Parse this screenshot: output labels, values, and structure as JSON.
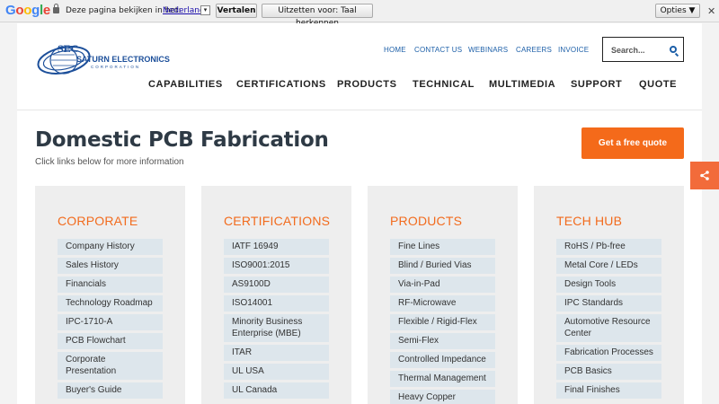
{
  "translate_bar": {
    "logo": [
      "G",
      "o",
      "o",
      "g",
      "l",
      "e"
    ],
    "prompt": "Deze pagina bekijken in het:",
    "language": "Nederlands",
    "translate_button": "Vertalen",
    "disable_button": "Uitzetten voor: Taal herkennen",
    "options_button": "Opties ▼",
    "close": "✕"
  },
  "header": {
    "logo_text_1": "SEC",
    "logo_text_2": "SATURN ELECTRONICS",
    "logo_text_3": "CORPORATION",
    "top_links": [
      "HOME",
      "CONTACT US",
      "WEBINARS",
      "CAREERS",
      "INVOICE"
    ],
    "search_placeholder": "Search...",
    "main_nav": [
      "CAPABILITIES",
      "CERTIFICATIONS",
      "PRODUCTS",
      "TECHNICAL",
      "MULTIMEDIA",
      "SUPPORT",
      "QUOTE"
    ]
  },
  "page": {
    "title": "Domestic PCB Fabrication",
    "subtitle": "Click links below for more information",
    "quote_button": "Get a free quote"
  },
  "colors": {
    "accent": "#f46a1a",
    "nav_blue": "#1c5fa8",
    "link_bg": "#dde6ec"
  },
  "columns": [
    {
      "heading": "CORPORATE",
      "items": [
        "Company History",
        "Sales History",
        "Financials",
        "Technology Roadmap",
        "IPC-1710-A",
        "PCB Flowchart",
        "Corporate Presentation",
        "Buyer's Guide"
      ]
    },
    {
      "heading": "CERTIFICATIONS",
      "items": [
        "IATF 16949",
        "ISO9001:2015",
        "AS9100D",
        "ISO14001",
        "Minority Business Enterprise (MBE)",
        "ITAR",
        "UL USA",
        "UL Canada"
      ]
    },
    {
      "heading": "PRODUCTS",
      "items": [
        "Fine Lines",
        "Blind / Buried Vias",
        "Via-in-Pad",
        "RF-Microwave",
        "Flexible / Rigid-Flex",
        "Semi-Flex",
        "Controlled Impedance",
        "Thermal Management",
        "Heavy Copper"
      ]
    },
    {
      "heading": "TECH HUB",
      "items": [
        "RoHS / Pb-free",
        "Metal Core / LEDs",
        "Design Tools",
        "IPC Standards",
        "Automotive Resource Center",
        "Fabrication Processes",
        "PCB Basics",
        "Final Finishes"
      ]
    }
  ]
}
